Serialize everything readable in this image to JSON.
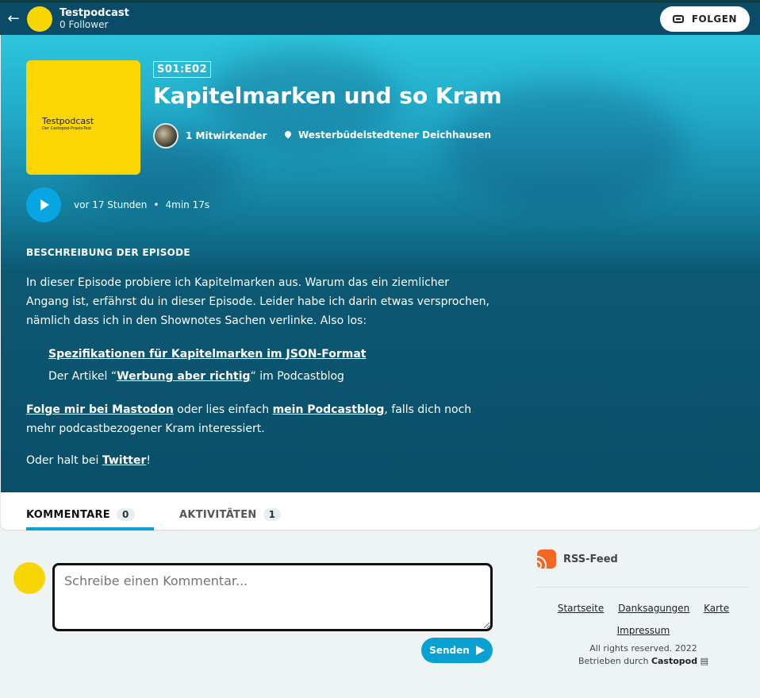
{
  "topbar": {
    "podcast_name": "Testpodcast",
    "followers": "0 Follower",
    "follow_label": "FOLGEN"
  },
  "episode": {
    "cover_title": "Testpodcast",
    "cover_subtitle": "Der Castopod-Praxis-Test",
    "season_episode": "S01:E02",
    "title": "Kapitelmarken und so Kram",
    "contributors": "1 Mitwirkender",
    "location": "Westerbüdelstedtener Deichhausen",
    "published": "vor 17 Stunden",
    "separator": "•",
    "duration": "4min 17s"
  },
  "description": {
    "heading": "BESCHREIBUNG DER EPISODE",
    "p1": "In dieser Episode probiere ich Kapitelmarken aus. Warum das ein ziemlicher Angang ist, erfährst du in dieser Episode. Leider habe ich darin etwas versprochen, nämlich dass ich in den Shownotes Sachen verlinke. Also los:",
    "link1": "Spezifikationen für Kapitelmarken im JSON-Format",
    "li2_pre": "Der Artikel “",
    "link2": "Werbung aber richtig",
    "li2_post": "“ im Podcastblog",
    "link3": "Folge mir bei Mastodon",
    "p2_mid": " oder lies einfach ",
    "link4": "mein Podcastblog",
    "p2_post": ", falls dich noch mehr podcastbezogener Kram interessiert.",
    "p3_pre": "Oder halt bei ",
    "link5": "Twitter",
    "p3_post": "!"
  },
  "tabs": [
    {
      "label": "KOMMENTARE",
      "count": "0"
    },
    {
      "label": "AKTIVITÄTEN",
      "count": "1"
    }
  ],
  "comment": {
    "placeholder": "Schreibe einen Kommentar...",
    "send_label": "Senden"
  },
  "sidebar": {
    "rss_label": "RSS-Feed",
    "links": [
      "Startseite",
      "Danksagungen",
      "Karte",
      "Impressum"
    ],
    "rights": "All rights reserved. 2022",
    "powered_pre": "Betrieben durch ",
    "powered_by": "Castopod"
  },
  "colors": {
    "topbar": "#0a4c68",
    "accent": "#08a1d2",
    "cover": "#fcd603",
    "rss": "#f26822"
  }
}
